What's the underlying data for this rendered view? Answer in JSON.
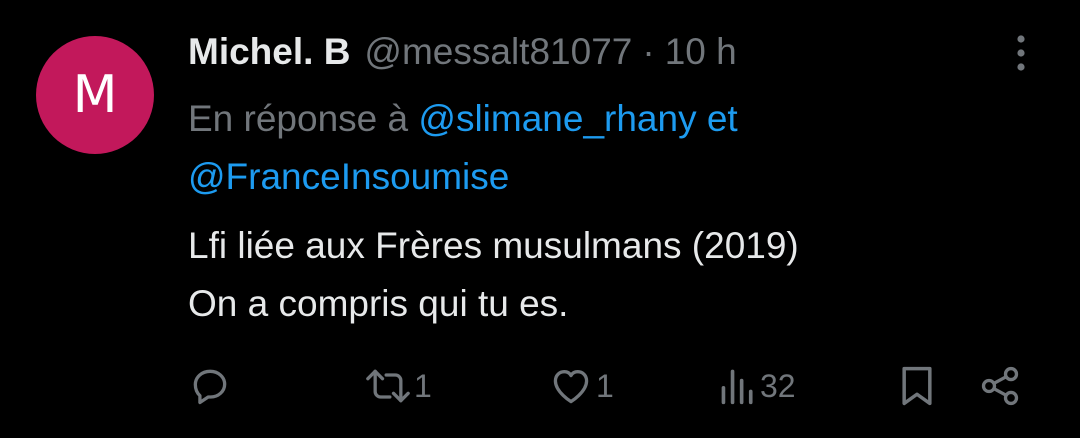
{
  "author": {
    "avatar_letter": "M",
    "avatar_color": "#c2185b",
    "name": "Michel. B",
    "handle": "@messalt81077",
    "separator": "·",
    "time": "10 h"
  },
  "reply_to": {
    "prefix": "En réponse à",
    "mention1": "@slimane_rhany",
    "conjunction": "et",
    "mention2": "@FranceInsoumise"
  },
  "tweet": {
    "line1": "Lfi liée aux Frères musulmans (2019)",
    "line2": "On a compris qui tu es."
  },
  "actions": {
    "reply_icon": "reply-icon",
    "retweet_count": "1",
    "like_count": "1",
    "views_count": "32"
  },
  "colors": {
    "background": "#000000",
    "text": "#e7e9ea",
    "muted": "#71767b",
    "accent": "#1d9bf0"
  }
}
